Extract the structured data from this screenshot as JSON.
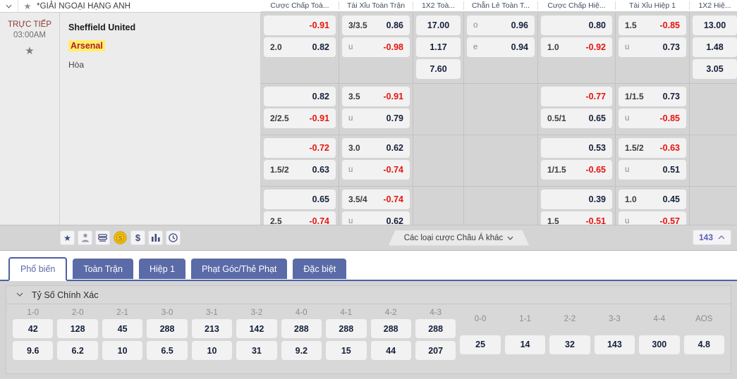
{
  "league": {
    "chevron_icon": "chevron-down-icon",
    "star_icon": "star-icon",
    "name": "*GIẢI NGOẠI HẠNG ANH"
  },
  "match": {
    "status": "TRỰC TIẾP",
    "time": "03:00AM",
    "favorite_icon": "star-icon",
    "home_team": "Sheffield United",
    "away_team": "Arsenal",
    "draw_label": "Hòa"
  },
  "columns": [
    {
      "label": "Cược Chấp Toà...",
      "width": 110
    },
    {
      "label": "Tài Xỉu Toàn Trận",
      "width": 105
    },
    {
      "label": "1X2 Toà...",
      "width": 72
    },
    {
      "label": "Chẵn Lẻ Toàn T...",
      "width": 105
    },
    {
      "label": "Cược Chấp Hiệ...",
      "width": 110
    },
    {
      "label": "Tài Xỉu Hiệp 1",
      "width": 105
    },
    {
      "label": "1X2 Hiệ...",
      "width": 72
    }
  ],
  "odds_rows": [
    {
      "handicap_ft": [
        {
          "hcp": "",
          "val": "-0.91",
          "down": true
        },
        {
          "hcp": "2.0",
          "val": "0.82",
          "down": false
        }
      ],
      "ou_ft": [
        {
          "hcp": "3/3.5",
          "val": "0.86",
          "down": false
        },
        {
          "hcp": "u",
          "val": "-0.98",
          "down": true,
          "lc": true
        }
      ],
      "x12_ft": [
        {
          "val": "17.00"
        },
        {
          "val": "1.17"
        },
        {
          "val": "7.60"
        }
      ],
      "oddeven_ft": [
        {
          "hcp": "o",
          "val": "0.96",
          "down": false,
          "lc": true
        },
        {
          "hcp": "e",
          "val": "0.94",
          "down": false,
          "lc": true
        }
      ],
      "handicap_h1": [
        {
          "hcp": "",
          "val": "0.80",
          "down": false
        },
        {
          "hcp": "1.0",
          "val": "-0.92",
          "down": true
        }
      ],
      "ou_h1": [
        {
          "hcp": "1.5",
          "val": "-0.85",
          "down": true
        },
        {
          "hcp": "u",
          "val": "0.73",
          "down": false,
          "lc": true
        }
      ],
      "x12_h1": [
        {
          "val": "13.00"
        },
        {
          "val": "1.48"
        },
        {
          "val": "3.05"
        }
      ]
    },
    {
      "handicap_ft": [
        {
          "hcp": "",
          "val": "0.82",
          "down": false
        },
        {
          "hcp": "2/2.5",
          "val": "-0.91",
          "down": true
        }
      ],
      "ou_ft": [
        {
          "hcp": "3.5",
          "val": "-0.91",
          "down": true
        },
        {
          "hcp": "u",
          "val": "0.79",
          "down": false,
          "lc": true
        }
      ],
      "x12_ft": [],
      "oddeven_ft": [],
      "handicap_h1": [
        {
          "hcp": "",
          "val": "-0.77",
          "down": true
        },
        {
          "hcp": "0.5/1",
          "val": "0.65",
          "down": false
        }
      ],
      "ou_h1": [
        {
          "hcp": "1/1.5",
          "val": "0.73",
          "down": false
        },
        {
          "hcp": "u",
          "val": "-0.85",
          "down": true,
          "lc": true
        }
      ],
      "x12_h1": []
    },
    {
      "handicap_ft": [
        {
          "hcp": "",
          "val": "-0.72",
          "down": true
        },
        {
          "hcp": "1.5/2",
          "val": "0.63",
          "down": false
        }
      ],
      "ou_ft": [
        {
          "hcp": "3.0",
          "val": "0.62",
          "down": false
        },
        {
          "hcp": "u",
          "val": "-0.74",
          "down": true,
          "lc": true
        }
      ],
      "x12_ft": [],
      "oddeven_ft": [],
      "handicap_h1": [
        {
          "hcp": "",
          "val": "0.53",
          "down": false
        },
        {
          "hcp": "1/1.5",
          "val": "-0.65",
          "down": true
        }
      ],
      "ou_h1": [
        {
          "hcp": "1.5/2",
          "val": "-0.63",
          "down": true
        },
        {
          "hcp": "u",
          "val": "0.51",
          "down": false,
          "lc": true
        }
      ],
      "x12_h1": []
    },
    {
      "handicap_ft": [
        {
          "hcp": "",
          "val": "0.65",
          "down": false
        },
        {
          "hcp": "2.5",
          "val": "-0.74",
          "down": true
        }
      ],
      "ou_ft": [
        {
          "hcp": "3.5/4",
          "val": "-0.74",
          "down": true
        },
        {
          "hcp": "u",
          "val": "0.62",
          "down": false,
          "lc": true
        }
      ],
      "x12_ft": [],
      "oddeven_ft": [],
      "handicap_h1": [
        {
          "hcp": "",
          "val": "0.39",
          "down": false
        },
        {
          "hcp": "1.5",
          "val": "-0.51",
          "down": true
        }
      ],
      "ou_h1": [
        {
          "hcp": "1.0",
          "val": "0.45",
          "down": false
        },
        {
          "hcp": "u",
          "val": "-0.57",
          "down": true,
          "lc": true
        }
      ],
      "x12_h1": []
    }
  ],
  "toolbar": {
    "icons": [
      {
        "name": "star-icon",
        "glyph": "★"
      },
      {
        "name": "player-icon",
        "glyph": "♟"
      },
      {
        "name": "stack-icon",
        "glyph": "≋"
      },
      {
        "name": "coin-icon",
        "glyph": "$"
      },
      {
        "name": "dollar-icon",
        "glyph": "$"
      },
      {
        "name": "bar-chart-icon",
        "glyph": "▥"
      },
      {
        "name": "clock-icon",
        "glyph": "◷"
      }
    ],
    "asia_more_label": "Các loại cược Châu Á khác",
    "asia_more_icon": "chevron-down-icon",
    "count": "143",
    "count_icon": "chevron-up-icon"
  },
  "tabs": [
    {
      "label": "Phổ biến",
      "active": true
    },
    {
      "label": "Toàn Trận",
      "active": false
    },
    {
      "label": "Hiệp 1",
      "active": false
    },
    {
      "label": "Phạt Góc/Thẻ Phạt",
      "active": false
    },
    {
      "label": "Đặc biệt",
      "active": false
    }
  ],
  "correct_score": {
    "chevron_icon": "chevron-down-icon",
    "title": "Tỷ Số Chính Xác",
    "columns": [
      {
        "label": "1-0",
        "values": [
          "42",
          "9.6"
        ]
      },
      {
        "label": "2-0",
        "values": [
          "128",
          "6.2"
        ]
      },
      {
        "label": "2-1",
        "values": [
          "45",
          "10"
        ]
      },
      {
        "label": "3-0",
        "values": [
          "288",
          "6.5"
        ]
      },
      {
        "label": "3-1",
        "values": [
          "213",
          "10"
        ]
      },
      {
        "label": "3-2",
        "values": [
          "142",
          "31"
        ]
      },
      {
        "label": "4-0",
        "values": [
          "288",
          "9.2"
        ]
      },
      {
        "label": "4-1",
        "values": [
          "288",
          "15"
        ]
      },
      {
        "label": "4-2",
        "values": [
          "288",
          "44"
        ]
      },
      {
        "label": "4-3",
        "values": [
          "288",
          "207"
        ]
      },
      {
        "label": "0-0",
        "values": [
          "25"
        ]
      },
      {
        "label": "1-1",
        "values": [
          "14"
        ]
      },
      {
        "label": "2-2",
        "values": [
          "32"
        ]
      },
      {
        "label": "3-3",
        "values": [
          "143"
        ]
      },
      {
        "label": "4-4",
        "values": [
          "300"
        ]
      },
      {
        "label": "AOS",
        "values": [
          "4.8"
        ]
      }
    ]
  },
  "colors": {
    "accent_blue": "#5a6ba8",
    "down_red": "#e8130f",
    "highlight_yellow": "#ffee6e",
    "away_team_red": "#b32020",
    "live_red": "#8b3a2e",
    "count_purple": "#5b5bbd"
  }
}
